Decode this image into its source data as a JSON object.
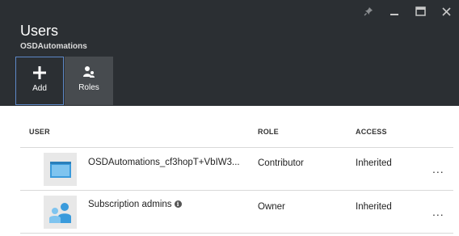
{
  "blade": {
    "title": "Users",
    "subtitle": "OSDAutomations"
  },
  "window_controls": {
    "icons": [
      "pin-icon",
      "minimize-icon",
      "maximize-icon",
      "close-icon"
    ]
  },
  "commands": {
    "add_label": "Add",
    "roles_label": "Roles"
  },
  "table": {
    "columns": [
      "USER",
      "ROLE",
      "ACCESS"
    ],
    "rows": [
      {
        "user": "OSDAutomations_cf3hopT+VbIW3...",
        "role": "Contributor",
        "access": "Inherited",
        "icon": "application-icon"
      },
      {
        "user": "Subscription admins",
        "role": "Owner",
        "access": "Inherited",
        "icon": "group-icon"
      }
    ],
    "more_label": "..."
  },
  "colors": {
    "header_bg": "#2b2f33",
    "add_border": "#5d88c8",
    "roles_bg": "#474b4f",
    "app_icon_blue": "#3a9bdc",
    "group_icon_blue": "#3a9bdc"
  }
}
